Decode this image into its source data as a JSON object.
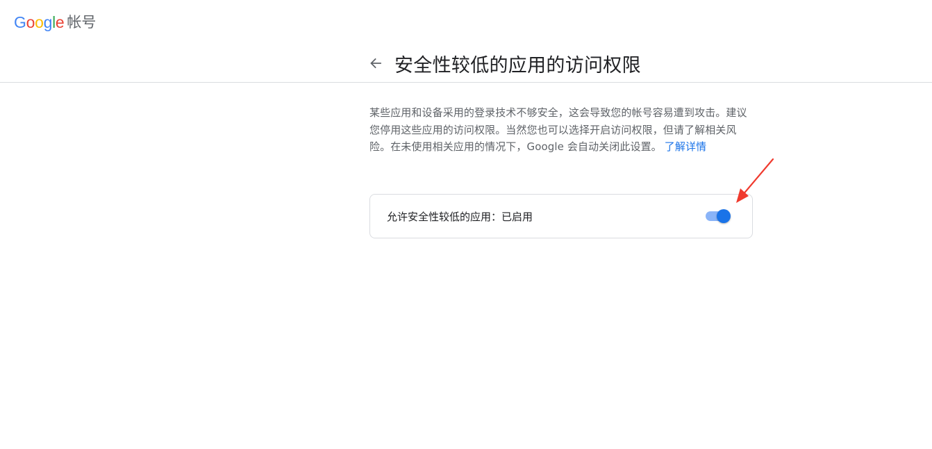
{
  "header": {
    "logo_letters": [
      "G",
      "o",
      "o",
      "g",
      "l",
      "e"
    ],
    "logo_colors": [
      "#4285F4",
      "#EA4335",
      "#FBBC05",
      "#4285F4",
      "#34A853",
      "#EA4335"
    ],
    "product_name": "帐号"
  },
  "title_row": {
    "back_icon": "arrow-left-icon",
    "title": "安全性较低的应用的访问权限"
  },
  "description": {
    "text": "某些应用和设备采用的登录技术不够安全，这会导致您的帐号容易遭到攻击。建议您停用这些应用的访问权限。当然您也可以选择开启访问权限，但请了解相关风险。在未使用相关应用的情况下，Google 会自动关闭此设置。",
    "learn_more_label": "了解详情",
    "link_color": "#1a73e8"
  },
  "setting": {
    "label": "允许安全性较低的应用：已启用",
    "enabled": true,
    "accent_color": "#1a73e8"
  },
  "annotation": {
    "icon": "red-arrow-icon",
    "color": "#f03a2e"
  }
}
